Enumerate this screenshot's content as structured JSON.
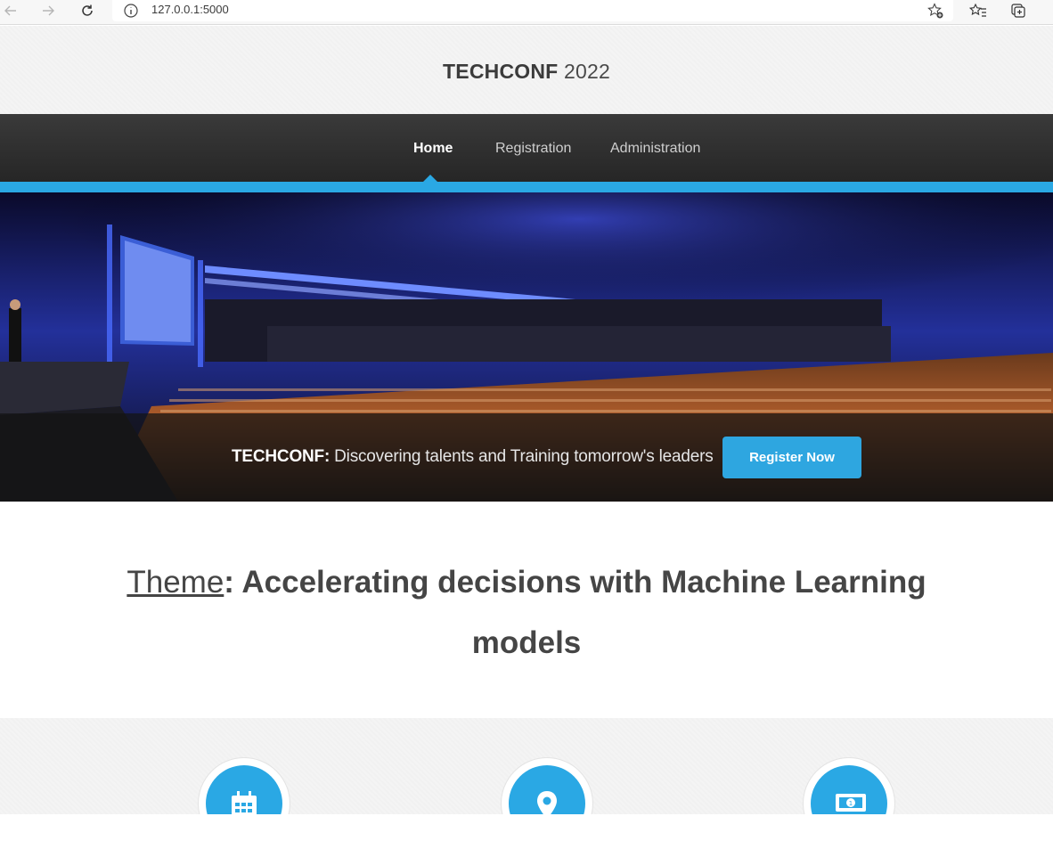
{
  "browser": {
    "url": "127.0.0.1:5000",
    "icons": [
      "back-icon",
      "forward-icon",
      "refresh-icon",
      "info-icon",
      "add-favorite-icon",
      "favorites-icon",
      "collections-icon"
    ]
  },
  "header": {
    "brand": "TECHCONF",
    "year": " 2022"
  },
  "nav": {
    "items": [
      {
        "label": "Home",
        "active": true
      },
      {
        "label": "Registration",
        "active": false
      },
      {
        "label": "Administration",
        "active": false
      }
    ]
  },
  "hero": {
    "brand": "TECHCONF:",
    "tagline": " Discovering talents and Training tomorrow's leaders",
    "register_label": "Register Now"
  },
  "theme": {
    "label": "Theme",
    "text_line1": ": Accelerating decisions with Machine Learning",
    "text_line2": "models"
  },
  "features": {
    "icons": [
      "calendar-icon",
      "map-pin-icon",
      "money-icon"
    ]
  },
  "colors": {
    "accent": "#2aa8e4",
    "nav_bg": "#2e2e2e",
    "button": "#2ea6e0"
  }
}
